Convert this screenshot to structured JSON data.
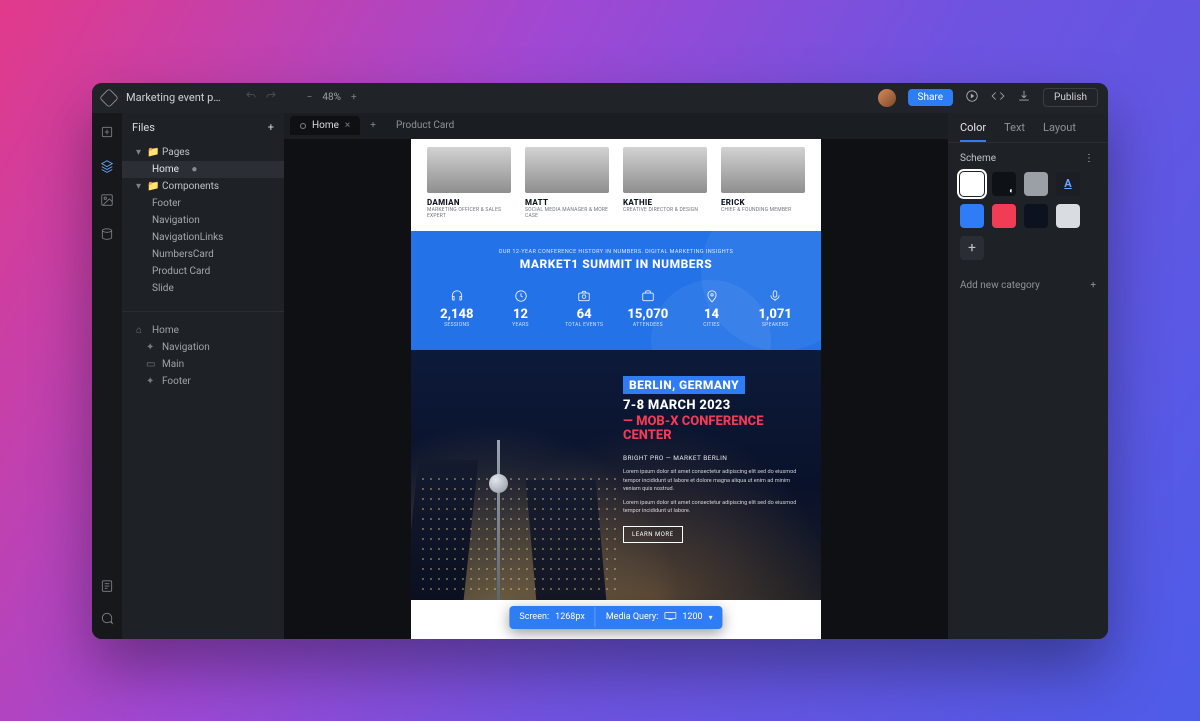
{
  "topbar": {
    "project_name": "Marketing event p…",
    "zoom_level": "48%",
    "share_label": "Share",
    "publish_label": "Publish"
  },
  "left_panel": {
    "files_label": "Files",
    "pages_group": "Pages",
    "pages": [
      "Home"
    ],
    "components_group": "Components",
    "components": [
      "Footer",
      "Navigation",
      "NavigationLinks",
      "NumbersCard",
      "Product Card",
      "Slide"
    ],
    "outline_root": "Home",
    "outline": [
      "Navigation",
      "Main",
      "Footer"
    ]
  },
  "tabs": [
    {
      "label": "Home",
      "active": true
    },
    {
      "label": "Product Card",
      "active": false
    }
  ],
  "team": [
    {
      "name": "DAMIAN",
      "role": "MARKETING OFFICER & SALES EXPERT"
    },
    {
      "name": "MATT",
      "role": "SOCIAL MEDIA MANAGER & MORE CASE"
    },
    {
      "name": "KATHIE",
      "role": "CREATIVE DIRECTOR & DESIGN"
    },
    {
      "name": "ERICK",
      "role": "CHIEF & FOUNDING MEMBER"
    }
  ],
  "numbers": {
    "eyebrow": "OUR 12-YEAR CONFERENCE HISTORY IN NUMBERS. DIGITAL MARKETING INSIGHTS",
    "title": "MARKET1 SUMMIT IN NUMBERS",
    "stats": [
      {
        "value": "2,148",
        "label": "SESSIONS"
      },
      {
        "value": "12",
        "label": "YEARS"
      },
      {
        "value": "64",
        "label": "TOTAL EVENTS"
      },
      {
        "value": "15,070",
        "label": "ATTENDEES"
      },
      {
        "value": "14",
        "label": "CITIES"
      },
      {
        "value": "1,071",
        "label": "SPEAKERS"
      }
    ]
  },
  "hero": {
    "location": "BERLIN, GERMANY",
    "date": "7-8 MARCH 2023",
    "venue": "— MOB-X CONFERENCE CENTER",
    "sub": "BRIGHT PRO — MARKET BERLIN",
    "para1": "Lorem ipsum dolor sit amet consectetur adipiscing elit sed do eiusmod tempor incididunt ut labore et dolore magna aliqua ut enim ad minim veniam quis nostrud.",
    "para2": "Lorem ipsum dolor sit amet consectetur adipiscing elit sed do eiusmod tempor incididunt ut labore.",
    "cta": "LEARN MORE"
  },
  "bottom_bar": {
    "screen_label": "Screen:",
    "screen_value": "1268px",
    "media_label": "Media Query:",
    "media_value": "1200"
  },
  "right_panel": {
    "tabs": [
      "Color",
      "Text",
      "Layout"
    ],
    "scheme_label": "Scheme",
    "add_category": "Add new category",
    "swatches": [
      {
        "cls": "sw-white",
        "selected": true
      },
      {
        "cls": "sw-nearblack"
      },
      {
        "cls": "sw-gray"
      },
      {
        "cls": "sw-letter",
        "glyph": "A"
      },
      {
        "cls": "sw-blue"
      },
      {
        "cls": "sw-pink"
      },
      {
        "cls": "sw-dark"
      },
      {
        "cls": "sw-light"
      },
      {
        "cls": "sw-add",
        "glyph": "+"
      }
    ]
  }
}
